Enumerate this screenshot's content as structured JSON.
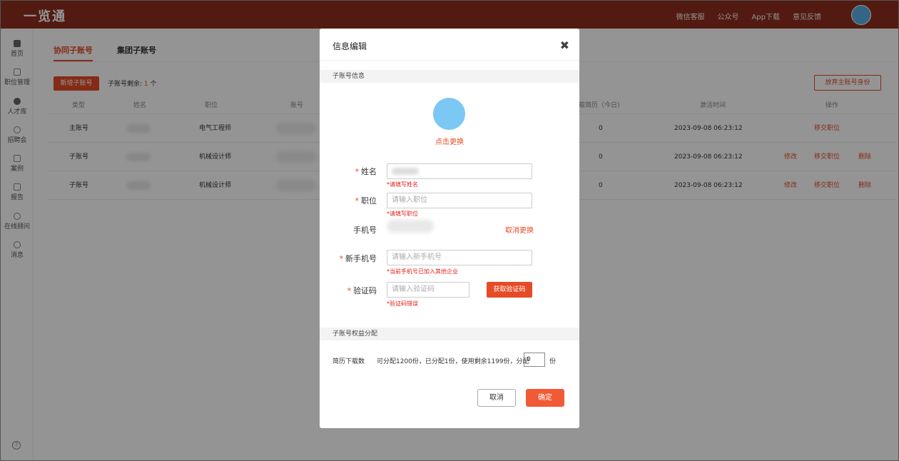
{
  "header": {
    "logo": "一览通",
    "nav": [
      "微信客服",
      "公众号",
      "App下载",
      "意见反馈"
    ]
  },
  "sidebar": {
    "items": [
      {
        "label": "首页",
        "icon": "home-icon"
      },
      {
        "label": "职位管理",
        "icon": "briefcase-icon"
      },
      {
        "label": "人才库",
        "icon": "person-icon"
      },
      {
        "label": "招聘会",
        "icon": "fair-icon"
      },
      {
        "label": "案例",
        "icon": "case-icon"
      },
      {
        "label": "报告",
        "icon": "report-icon"
      },
      {
        "label": "在线顾问",
        "icon": "consultant-icon"
      },
      {
        "label": "消息",
        "icon": "message-icon"
      }
    ]
  },
  "main": {
    "tabs": [
      "协同子账号",
      "集团子账号"
    ],
    "add_button": "新增子账号",
    "remain_label": "子账号剩余:",
    "remain_count": "1",
    "remain_unit": "个",
    "abandon_button": "放弃主账号身份",
    "table": {
      "headers": [
        "类型",
        "姓名",
        "职位",
        "账号",
        "载简历（今日)",
        "激活时间",
        "操作"
      ],
      "rows": [
        {
          "type": "主账号",
          "position": "电气工程师",
          "downloads": "0",
          "activated": "2023-09-08 06:23:12",
          "ops": [
            "移交职位"
          ]
        },
        {
          "type": "子账号",
          "position": "机械设计师",
          "downloads": "0",
          "activated": "2023-09-08 06:23:12",
          "ops": [
            "修改",
            "移交职位",
            "删除"
          ]
        },
        {
          "type": "子账号",
          "position": "机械设计师",
          "downloads": "0",
          "activated": "2023-09-08 06:23:12",
          "ops": [
            "修改",
            "移交职位",
            "删除"
          ]
        }
      ]
    }
  },
  "modal": {
    "title": "信息编辑",
    "section_info": "子账号信息",
    "change_avatar": "点击更换",
    "name_label": "姓名",
    "name_error": "*请填写姓名",
    "position_label": "职位",
    "position_placeholder": "请输入职位",
    "position_error": "*请填写职位",
    "phone_label": "手机号",
    "cancel_change": "取消更换",
    "new_phone_label": "新手机号",
    "new_phone_placeholder": "请输入新手机号",
    "new_phone_error": "*当前手机号已加入其他企业",
    "code_label": "验证码",
    "code_placeholder": "请输入验证码",
    "code_button": "获取验证码",
    "code_error": "*验证码错误",
    "section_rights": "子账号权益分配",
    "download_label": "简历下载数",
    "download_desc": "可分配1200份，已分配1份，使用剩余1199份，分配",
    "download_value": "0",
    "download_unit": "份",
    "cancel_button": "取消",
    "ok_button": "确定"
  }
}
